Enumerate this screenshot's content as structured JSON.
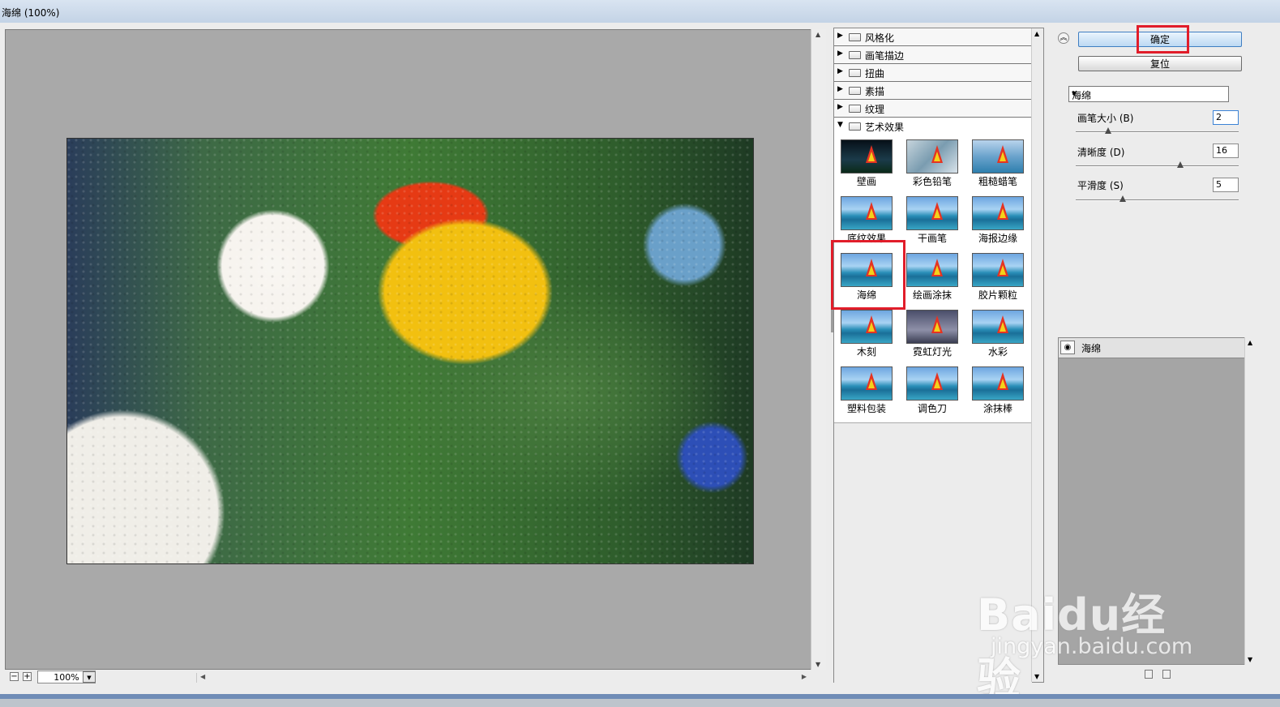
{
  "window": {
    "title": "海绵 (100%)"
  },
  "status": {
    "zoom": "100%",
    "zoom_out": "−",
    "zoom_in": "+"
  },
  "filter_categories": [
    {
      "label": "风格化",
      "expanded": false
    },
    {
      "label": "画笔描边",
      "expanded": false
    },
    {
      "label": "扭曲",
      "expanded": false
    },
    {
      "label": "素描",
      "expanded": false
    },
    {
      "label": "纹理",
      "expanded": false
    },
    {
      "label": "艺术效果",
      "expanded": true
    }
  ],
  "artistic_filters": [
    "壁画",
    "彩色铅笔",
    "粗糙蜡笔",
    "底纹效果",
    "干画笔",
    "海报边缘",
    "海绵",
    "绘画涂抹",
    "胶片颗粒",
    "木刻",
    "霓虹灯光",
    "水彩",
    "塑料包装",
    "调色刀",
    "涂抹棒"
  ],
  "selected_filter": "海绵",
  "buttons": {
    "ok": "确定",
    "reset": "复位"
  },
  "filter_dropdown": {
    "value": "海绵"
  },
  "params": [
    {
      "label": "画笔大小 (B)",
      "value": "2",
      "fraction": 0.2
    },
    {
      "label": "清晰度 (D)",
      "value": "16",
      "fraction": 0.64
    },
    {
      "label": "平滑度 (S)",
      "value": "5",
      "fraction": 0.29
    }
  ],
  "layers": [
    {
      "label": "海绵"
    }
  ],
  "watermark": {
    "main": "Baidu经验",
    "sub": "jingyan.baidu.com"
  }
}
